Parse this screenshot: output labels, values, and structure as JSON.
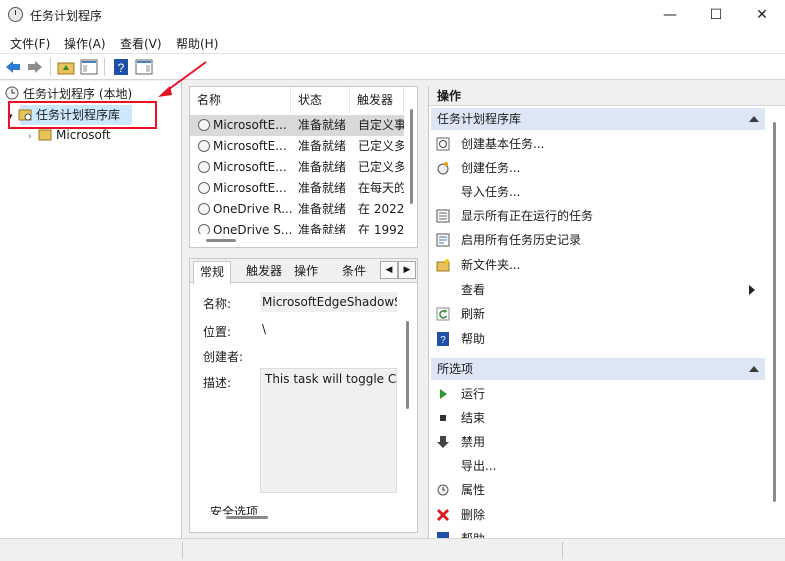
{
  "window": {
    "title": "任务计划程序",
    "min": "—",
    "max": "☐",
    "close": "✕"
  },
  "menu": [
    "文件(F)",
    "操作(A)",
    "查看(V)",
    "帮助(H)"
  ],
  "tree": {
    "root": "任务计划程序 (本地)",
    "library": "任务计划程序库",
    "child": "Microsoft"
  },
  "list": {
    "headers": [
      "名称",
      "状态",
      "触发器"
    ],
    "rows": [
      [
        "MicrosoftE...",
        "准备就绪",
        "自定义事"
      ],
      [
        "MicrosoftE...",
        "准备就绪",
        "已定义多"
      ],
      [
        "MicrosoftE...",
        "准备就绪",
        "已定义多"
      ],
      [
        "MicrosoftE...",
        "准备就绪",
        "在每天的"
      ],
      [
        "OneDrive R...",
        "准备就绪",
        "在 2022"
      ],
      [
        "OneDrive S...",
        "准备就绪",
        "在 1992"
      ]
    ]
  },
  "detail": {
    "tabs": [
      "常规",
      "触发器",
      "操作",
      "条件"
    ],
    "name_label": "名称:",
    "name_value": "MicrosoftEdgeShadowS",
    "location_label": "位置:",
    "location_value": "\\",
    "author_label": "创建者:",
    "desc_label": "描述:",
    "desc_value": "This task will toggle CE",
    "security_label": "安全选项"
  },
  "actions": {
    "header": "操作",
    "group1": "任务计划程序库",
    "items1": [
      {
        "label": "创建基本任务...",
        "icon": "create-basic-task-icon"
      },
      {
        "label": "创建任务...",
        "icon": "create-task-icon"
      },
      {
        "label": "导入任务...",
        "icon": "none"
      },
      {
        "label": "显示所有正在运行的任务",
        "icon": "running-tasks-icon"
      },
      {
        "label": "启用所有任务历史记录",
        "icon": "history-icon"
      },
      {
        "label": "新文件夹...",
        "icon": "new-folder-icon"
      },
      {
        "label": "查看",
        "icon": "none"
      },
      {
        "label": "刷新",
        "icon": "refresh-icon"
      },
      {
        "label": "帮助",
        "icon": "help-icon"
      }
    ],
    "group2": "所选项",
    "items2": [
      {
        "label": "运行",
        "icon": "run-icon"
      },
      {
        "label": "结束",
        "icon": "stop-icon"
      },
      {
        "label": "禁用",
        "icon": "disable-icon"
      },
      {
        "label": "导出...",
        "icon": "none"
      },
      {
        "label": "属性",
        "icon": "properties-icon"
      },
      {
        "label": "删除",
        "icon": "delete-icon"
      },
      {
        "label": "帮助",
        "icon": "help-icon"
      }
    ]
  },
  "colors": {
    "highlight": "#e81123",
    "selected": "#cce8ff",
    "group": "#dce6f4"
  }
}
